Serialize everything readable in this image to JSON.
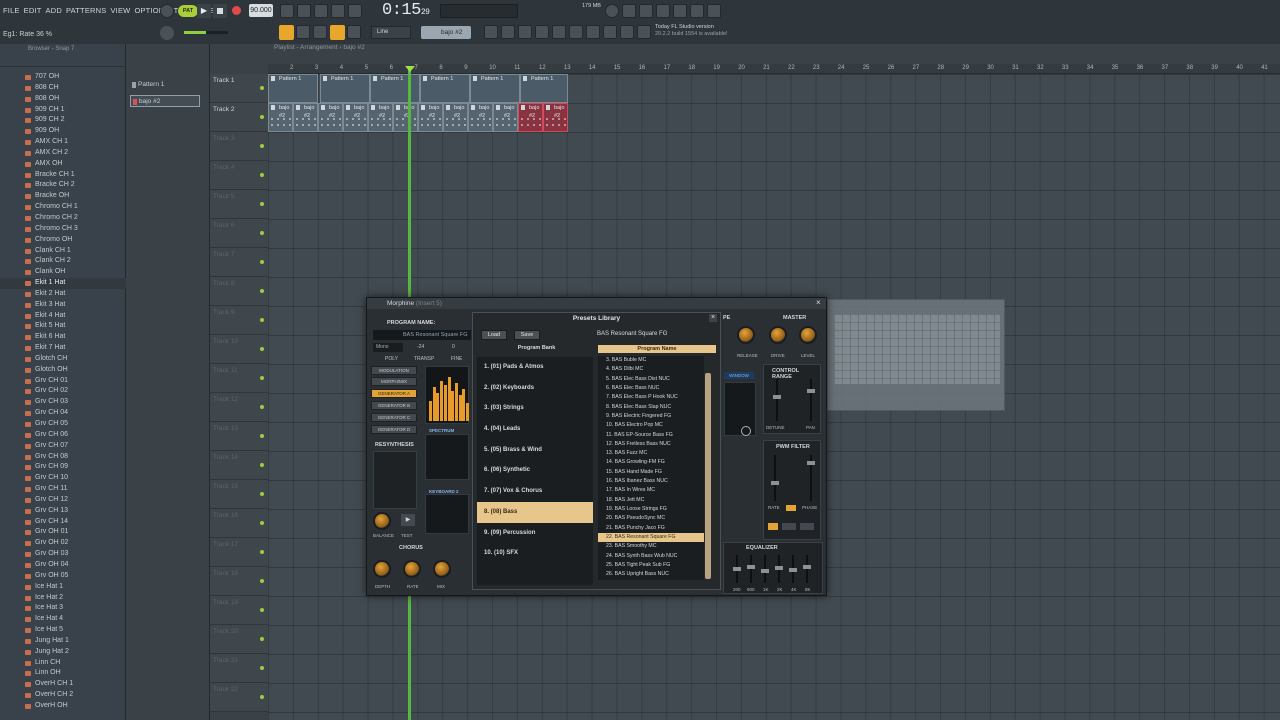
{
  "menu": [
    "FILE",
    "EDIT",
    "ADD",
    "PATTERNS",
    "VIEW",
    "OPTIONS",
    "TOOLS",
    "HELP"
  ],
  "hint": "Eg1: Rate 36 %",
  "transport": {
    "pattern_mode": "PAT",
    "tempo": "90.000",
    "time_main": "0:15",
    "time_sub": "29",
    "cpu": "179 MB"
  },
  "toolbar": {
    "snap": "Line",
    "pattern": "bajo #2"
  },
  "news": {
    "line1": "Today  FL Studio version",
    "line2": "20.2.2 build 1554 is available!"
  },
  "browser": {
    "header": "Browser - Snap 7",
    "items": [
      "707 OH",
      "808 CH",
      "808 OH",
      "909 CH 1",
      "909 CH 2",
      "909 OH",
      "AMX CH 1",
      "AMX CH 2",
      "AMX OH",
      "Bracke CH 1",
      "Bracke CH 2",
      "Bracke OH",
      "Chromo CH 1",
      "Chromo CH 2",
      "Chromo CH 3",
      "Chromo OH",
      "Clank CH 1",
      "Clank CH 2",
      "Clank OH",
      "Ekit 1 Hat",
      "Ekit 2 Hat",
      "Ekit 3 Hat",
      "Ekit 4 Hat",
      "Ekit 5 Hat",
      "Ekit 6 Hat",
      "Ekit 7 Hat",
      "Glotch CH",
      "Glotch OH",
      "Grv CH 01",
      "Grv CH 02",
      "Grv CH 03",
      "Grv CH 04",
      "Grv CH 05",
      "Grv CH 06",
      "Grv CH 07",
      "Grv CH 08",
      "Grv CH 09",
      "Grv CH 10",
      "Grv CH 11",
      "Grv CH 12",
      "Grv CH 13",
      "Grv CH 14",
      "Grv OH 01",
      "Grv OH 02",
      "Grv OH 03",
      "Grv OH 04",
      "Grv OH 05",
      "Ice Hat 1",
      "Ice Hat 2",
      "Ice Hat 3",
      "Ice Hat 4",
      "Ice Hat 5",
      "Jung Hat 1",
      "Jung Hat 2",
      "Linn CH",
      "Linn OH",
      "OverH CH 1",
      "OverH CH 2",
      "OverH OH"
    ],
    "selected": "Ekit 1 Hat"
  },
  "patterns": [
    "Pattern 1",
    "bajo #2"
  ],
  "playlist": {
    "title": "Playlist - Arrangement › bajo #2",
    "tracks": [
      "Track 1",
      "Track 2",
      "Track 3",
      "Track 4",
      "Track 5",
      "Track 6",
      "Track 7",
      "Track 8",
      "Track 9",
      "Track 10",
      "Track 11",
      "Track 12",
      "Track 13",
      "Track 14",
      "Track 15",
      "Track 16",
      "Track 17",
      "Track 18",
      "Track 19",
      "Track 20",
      "Track 21",
      "Track 22"
    ],
    "ruler": [
      "2",
      "3",
      "4",
      "5",
      "6",
      "7",
      "8",
      "9",
      "10",
      "11",
      "12",
      "13",
      "14",
      "15",
      "16",
      "17",
      "18",
      "19",
      "20",
      "21",
      "22",
      "23",
      "24",
      "25",
      "26",
      "27",
      "28",
      "29",
      "30",
      "31",
      "32",
      "33",
      "34",
      "35",
      "36",
      "37",
      "38",
      "39",
      "40",
      "41"
    ],
    "clip1": "Pattern 1",
    "clip2": "bajo #2"
  },
  "plugin": {
    "title": "Morphine",
    "subtitle": "(Insert 5)",
    "program_name_label": "PROGRAM NAME:",
    "program_name": "BAS Resonant Square FG",
    "mono": "Mono",
    "voices": "-24",
    "zero": "0",
    "labels": {
      "poly": "POLY",
      "transp": "TRANSP",
      "fine": "FINE",
      "resynthesis": "RESYNTHESIS",
      "chorus": "CHORUS",
      "equalizer": "EQUALIZER",
      "master": "MASTER",
      "control_range": "CONTROL RANGE",
      "pwm_filter": "PWM FILTER",
      "window": "WINDOW",
      "balance": "BALANCE",
      "test": "TEST",
      "depth": "DEPTH",
      "rate": "RATE",
      "mix": "MIX",
      "release": "RELEASE",
      "drive": "DRIVE",
      "level": "LEVEL",
      "detune": "DETUNE",
      "pan": "PAN",
      "phase": "PHASE",
      "pe": "PE",
      "breakpoint": "BREAKPOINT",
      "spectrum": "SPECTRUM",
      "keyboard": "KEYBOARD 2"
    },
    "mod_buttons": [
      "MODULATION",
      "MORPH/MIX",
      "GENERATOR A",
      "GENERATOR B",
      "GENERATOR C",
      "GENERATOR D"
    ],
    "eq_freqs": [
      "200",
      "500",
      "1K",
      "2K",
      "4K",
      "8K"
    ]
  },
  "presets": {
    "title": "Presets Library",
    "load": "Load",
    "save": "Save",
    "current": "BAS Resonant Square FG",
    "bank_header": "Program Bank",
    "program_header": "Program Name",
    "banks": [
      "1. (01) Pads & Atmos",
      "2. (02) Keyboards",
      "3. (03) Strings",
      "4. (04) Leads",
      "5. (05) Brass & Wind",
      "6. (06) Synthetic",
      "7. (07) Vox & Chorus",
      "8. (08) Bass",
      "9. (09) Percussion",
      "10. (10) SFX"
    ],
    "selected_bank": "8. (08) Bass",
    "programs": [
      "3. BAS Buble MC",
      "4. BAS Dilbi MC",
      "5. BAS Elec Bass Dist NUC",
      "6. BAS Elec Bass NUC",
      "7. BAS Elec Bass P Hook NUC",
      "8. BAS Elec Bass Slap NUC",
      "9. BAS Electric Fingered FG",
      "10. BAS Electro Pop MC",
      "11. BAS EP-Source Bass FG",
      "12. BAS Fretless Bass NUC",
      "13. BAS Fuzz MC",
      "14. BAS Growling-FM FG",
      "15. BAS Hand Made FG",
      "16. BAS Ibanez Bass NUC",
      "17. BAS In Wires MC",
      "18. BAS Jett MC",
      "19. BAS Loose Strings FG",
      "20. BAS PseudoSync MC",
      "21. BAS Punchy Jaco FG",
      "22. BAS Resonant Square FG",
      "23. BAS Smoothy MC",
      "24. BAS Synth Bass Wub NUC",
      "25. BAS Tight Peak Sub FG",
      "26. BAS Upright Bass NUC"
    ],
    "selected_program": "22. BAS Resonant Square FG"
  }
}
